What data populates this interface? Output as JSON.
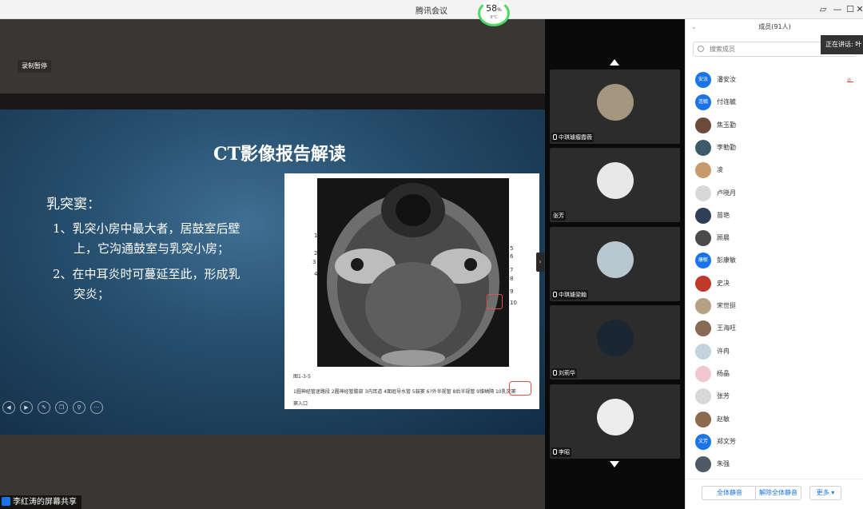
{
  "window": {
    "title": "腾讯会议",
    "battery": {
      "percent": "58",
      "unit": "%",
      "temp": "9°C"
    }
  },
  "share": {
    "recording_label": "录制暂停",
    "share_label": "李红涛的屏幕共享",
    "slide": {
      "title": "CT影像报告解读",
      "heading": "乳突窦：",
      "points": [
        "1、乳突小房中最大者，居鼓室后壁",
        "上，它沟通鼓室与乳突小房；",
        "2、在中耳炎时可蔓延至此，形成乳",
        "突炎；"
      ],
      "figure": {
        "labels_left": [
          "1",
          "2",
          "3",
          "4"
        ],
        "labels_right": [
          "5",
          "6",
          "7",
          "8",
          "9",
          "10"
        ],
        "caption_no": "图1-3-5",
        "caption": "1圆神经管迷路段 2圆神经管膝部 3内耳道 4面庭导水管 5鼓窦 6?外半规管 8后半规管 9锥鳞隔 10乳突窦",
        "caption_tail": "窦入口"
      }
    },
    "controls": [
      "prev-icon",
      "next-icon",
      "pen-icon",
      "copy-icon",
      "zoom-icon",
      "more-icon"
    ]
  },
  "videos": [
    {
      "name": "中琪璩瘤霞薇",
      "avatar_color": "#a5977f"
    },
    {
      "name": "张芳",
      "avatar_color": "#e8e8e8"
    },
    {
      "name": "中琪璩梁翰",
      "avatar_color": "#b9c7d1"
    },
    {
      "name": "刘莉华",
      "avatar_color": "#1b2633"
    },
    {
      "name": "李昭",
      "avatar_color": "#ededed"
    }
  ],
  "panel": {
    "header": "成员(91人)",
    "search_placeholder": "搜索成员",
    "speaking": "正在讲话: 叶",
    "members": [
      {
        "avatar": "安汝",
        "name": "潘安汝",
        "color": "#1a73e8"
      },
      {
        "avatar": "连毓",
        "name": "付连毓",
        "color": "#1a73e8"
      },
      {
        "avatar": "",
        "name": "焦玉勤",
        "color": "#6b4a3a"
      },
      {
        "avatar": "",
        "name": "李勒勤",
        "color": "#3d5a6b"
      },
      {
        "avatar": "",
        "name": "凌",
        "color": "#c89a6a"
      },
      {
        "avatar": "",
        "name": "卢晓月",
        "color": "#d8d8d8"
      },
      {
        "avatar": "",
        "name": "苗艳",
        "color": "#2f3f58"
      },
      {
        "avatar": "",
        "name": "顾晨",
        "color": "#4a4a4a"
      },
      {
        "avatar": "康敏",
        "name": "彭康敏",
        "color": "#1a73e8"
      },
      {
        "avatar": "",
        "name": "史决",
        "color": "#c0392b"
      },
      {
        "avatar": "",
        "name": "宋世挺",
        "color": "#b4a082"
      },
      {
        "avatar": "",
        "name": "王海旺",
        "color": "#8a6a55"
      },
      {
        "avatar": "",
        "name": "许冉",
        "color": "#c5d3dc"
      },
      {
        "avatar": "",
        "name": "杨晶",
        "color": "#f2c6cf"
      },
      {
        "avatar": "",
        "name": "张芳",
        "color": "#d8d8d8"
      },
      {
        "avatar": "",
        "name": "赵敏",
        "color": "#8b6a4e"
      },
      {
        "avatar": "文芳",
        "name": "郑文芳",
        "color": "#1a73e8"
      },
      {
        "avatar": "",
        "name": "朱强",
        "color": "#4e5a66"
      }
    ],
    "footer": {
      "mute_all": "全体静音",
      "unmute_all": "解除全体静音",
      "more": "更多 ▾"
    }
  }
}
